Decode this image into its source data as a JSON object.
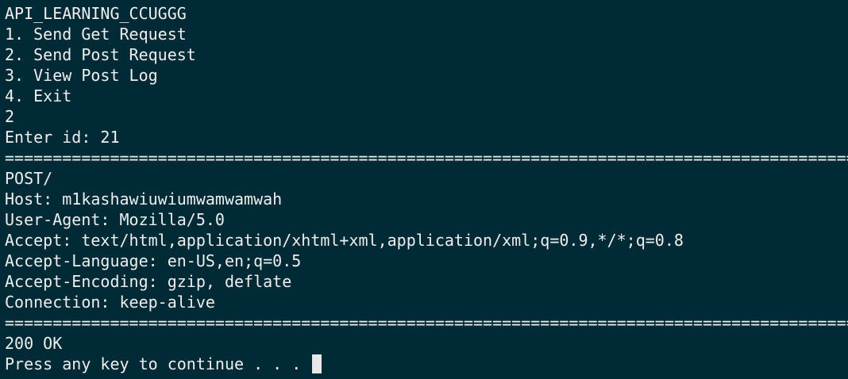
{
  "terminal": {
    "title_line": "API_LEARNING_CCUGGG",
    "menu": [
      "1. Send Get Request",
      "2. Send Post Request",
      "3. View Post Log",
      "4. Exit"
    ],
    "choice": "2",
    "id_prompt": "Enter id: 21",
    "separator": "=========================================================================================",
    "request": {
      "method_line": "POST/",
      "host": "Host: m1kashawiuwiumwamwamwah",
      "user_agent": "User-Agent: Mozilla/5.0",
      "accept": "Accept: text/html,application/xhtml+xml,application/xml;q=0.9,*/*;q=0.8",
      "accept_language": "Accept-Language: en-US,en;q=0.5",
      "accept_encoding": "Accept-Encoding: gzip, deflate",
      "connection": "Connection: keep-alive"
    },
    "status": "200 OK",
    "continue_prompt": "Press any key to continue . . . "
  }
}
